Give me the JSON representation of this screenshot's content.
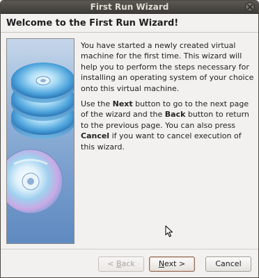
{
  "window": {
    "title": "First Run Wizard"
  },
  "header": {
    "title": "Welcome to the First Run Wizard!"
  },
  "body": {
    "paragraph1": "You have started a newly created virtual machine for the first time. This wizard will help you to perform the steps necessary for installing an operating system of your choice onto this virtual machine.",
    "p2_part1": "Use the ",
    "p2_next": "Next",
    "p2_part2": " button to go to the next page of the wizard and the ",
    "p2_back": "Back",
    "p2_part3": " button to return to the previous page. You can also press ",
    "p2_cancel": "Cancel",
    "p2_part4": " if you want to cancel execution of this wizard."
  },
  "buttons": {
    "back_prefix": "< ",
    "back_mnemonic": "B",
    "back_rest": "ack",
    "next_mnemonic": "N",
    "next_rest": "ext >",
    "cancel_label": "Cancel"
  },
  "icons": {
    "close": "close-icon",
    "cursor": "mouse-pointer-icon",
    "graphic": "cd-stack-illustration"
  },
  "colors": {
    "titlebar": "#3e3c38",
    "title_text": "#dfdbd2",
    "dialog_bg": "#f2f1f0",
    "panel_blue": "#6d95c8"
  }
}
